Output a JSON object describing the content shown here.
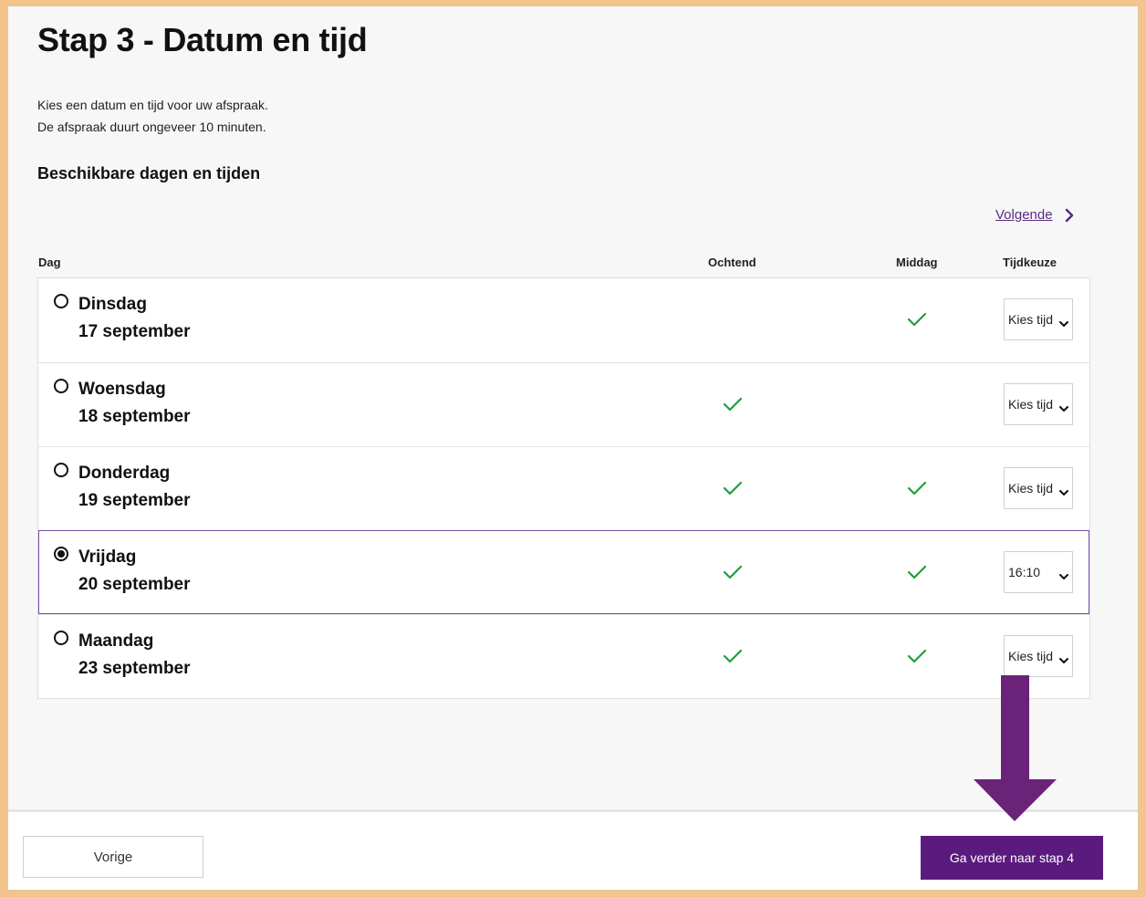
{
  "page": {
    "title": "Stap 3 - Datum en tijd",
    "intro_line1": "Kies een datum en tijd voor uw afspraak.",
    "intro_line2": "De afspraak duurt ongeveer 10 minuten.",
    "section_title": "Beschikbare dagen en tijden",
    "next_link": "Volgende"
  },
  "table": {
    "headers": {
      "day": "Dag",
      "morning": "Ochtend",
      "afternoon": "Middag",
      "time": "Tijdkeuze"
    },
    "rows": [
      {
        "day": "Dinsdag",
        "date": "17 september",
        "morning": false,
        "afternoon": true,
        "time": "Kies tijd",
        "selected": false
      },
      {
        "day": "Woensdag",
        "date": "18 september",
        "morning": true,
        "afternoon": false,
        "time": "Kies tijd",
        "selected": false
      },
      {
        "day": "Donderdag",
        "date": "19 september",
        "morning": true,
        "afternoon": true,
        "time": "Kies tijd",
        "selected": false
      },
      {
        "day": "Vrijdag",
        "date": "20 september",
        "morning": true,
        "afternoon": true,
        "time": "16:10",
        "selected": true
      },
      {
        "day": "Maandag",
        "date": "23 september",
        "morning": true,
        "afternoon": true,
        "time": "Kies tijd",
        "selected": false
      }
    ]
  },
  "footer": {
    "prev_label": "Vorige",
    "next_label": "Ga verder naar stap 4"
  },
  "colors": {
    "accent": "#5b1a7e",
    "link": "#5b2d83",
    "check": "#1f9e3a",
    "frame": "#f4c48d"
  },
  "icons": {
    "next": "chevron-right-icon",
    "check": "check-icon",
    "select": "chevron-down-icon",
    "annotation": "arrow-down-icon"
  }
}
